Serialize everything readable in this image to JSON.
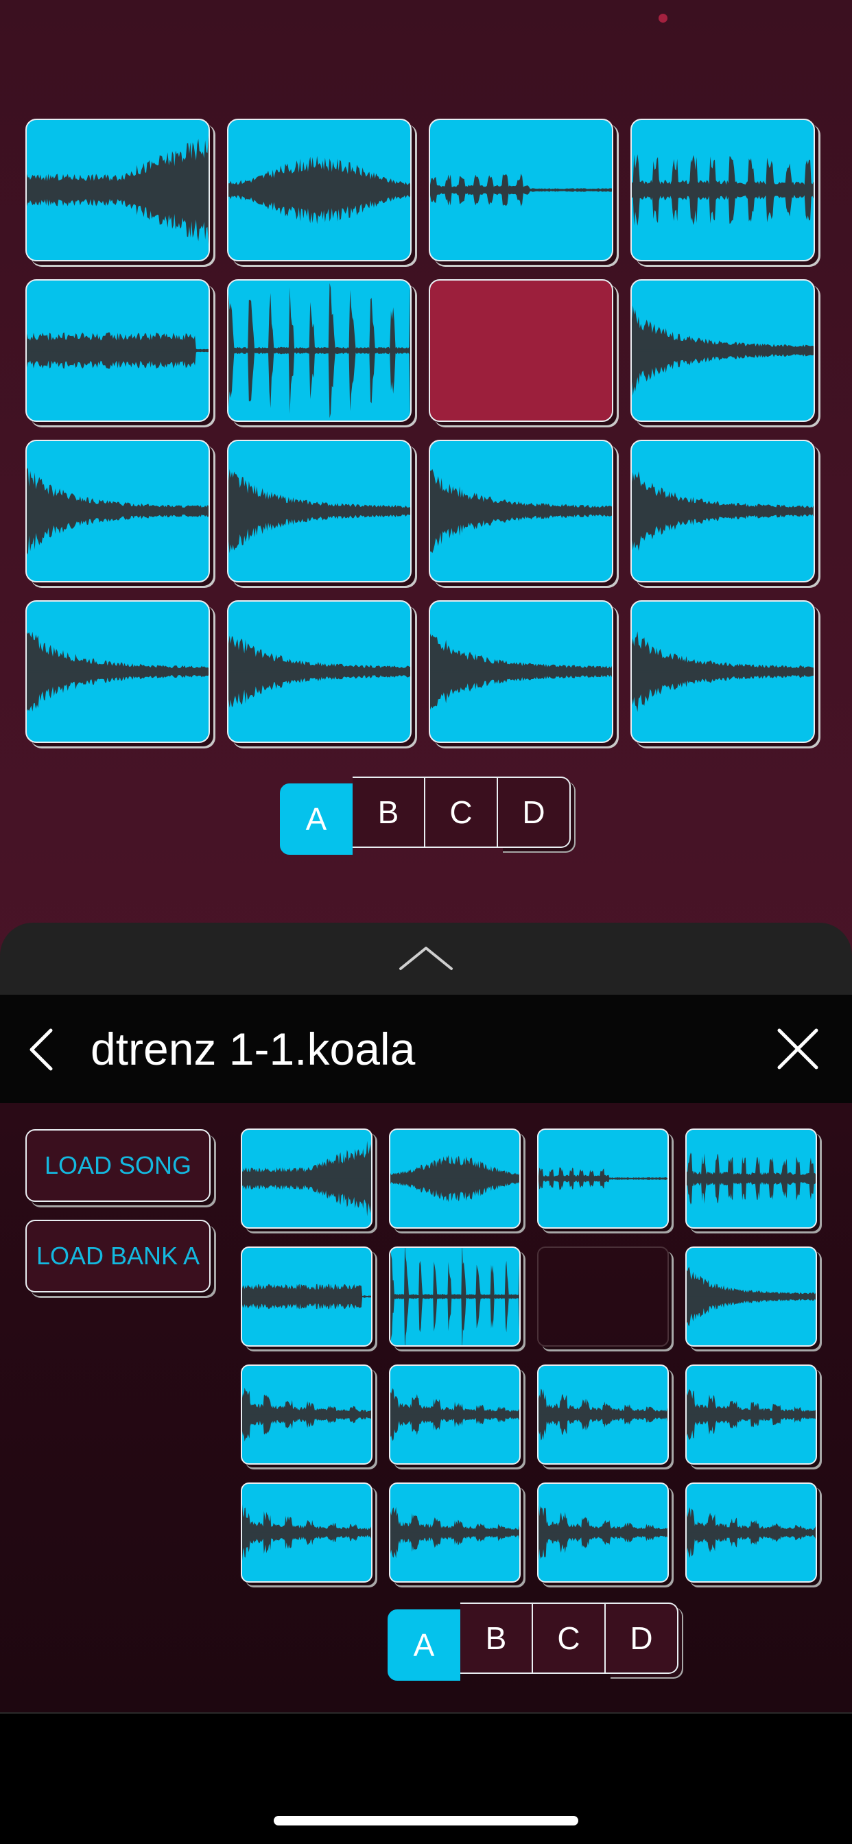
{
  "main_pads": [
    {
      "wave": "ramp"
    },
    {
      "wave": "swell"
    },
    {
      "wave": "ticks"
    },
    {
      "wave": "spiky"
    },
    {
      "wave": "block"
    },
    {
      "wave": "bursts"
    },
    {
      "wave": "none",
      "state": "active"
    },
    {
      "wave": "decay"
    },
    {
      "wave": "decay"
    },
    {
      "wave": "decay"
    },
    {
      "wave": "decay"
    },
    {
      "wave": "decay"
    },
    {
      "wave": "decay"
    },
    {
      "wave": "decay"
    },
    {
      "wave": "decay"
    },
    {
      "wave": "decay"
    }
  ],
  "main_banks": {
    "labels": [
      "A",
      "B",
      "C",
      "D"
    ],
    "selected": "A"
  },
  "browser": {
    "title": "dtrenz 1-1.koala",
    "load_song_label": "LOAD SONG",
    "load_bank_label": "LOAD BANK A",
    "pads": [
      {
        "wave": "ramp"
      },
      {
        "wave": "swell"
      },
      {
        "wave": "ticks"
      },
      {
        "wave": "spiky"
      },
      {
        "wave": "block"
      },
      {
        "wave": "bursts"
      },
      {
        "wave": "none",
        "state": "empty"
      },
      {
        "wave": "decay"
      },
      {
        "wave": "pulses"
      },
      {
        "wave": "pulses"
      },
      {
        "wave": "pulses"
      },
      {
        "wave": "pulses"
      },
      {
        "wave": "pulses"
      },
      {
        "wave": "pulses"
      },
      {
        "wave": "pulses"
      },
      {
        "wave": "pulses"
      }
    ],
    "banks": {
      "labels": [
        "A",
        "B",
        "C",
        "D"
      ],
      "selected": "A"
    }
  },
  "colors": {
    "pad": "#05c2ec",
    "active_pad": "#9c1f3c",
    "wave": "#2f3a40",
    "accent_text": "#14b9e0"
  },
  "icons": {
    "back": "chevron-left-icon",
    "close": "close-icon",
    "drawer": "chevron-up-icon"
  }
}
